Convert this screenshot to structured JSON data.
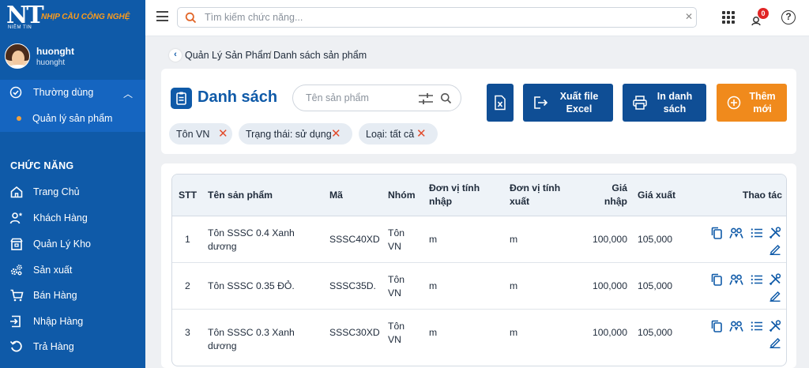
{
  "brand": {
    "logo_text": "NT",
    "logo_sub": "NIỀM TIN",
    "slogan": "NHỊP CẦU CÔNG NGHỆ"
  },
  "user": {
    "name": "huonght",
    "login": "huonght"
  },
  "favorites": {
    "label": "Thường dùng",
    "items": [
      {
        "label": "Quản lý sản phẩm"
      }
    ]
  },
  "section_title": "CHỨC NĂNG",
  "nav": [
    {
      "label": "Trang Chủ",
      "icon": "home-icon"
    },
    {
      "label": "Khách Hàng",
      "icon": "user-star-icon"
    },
    {
      "label": "Quản Lý Kho",
      "icon": "warehouse-icon"
    },
    {
      "label": "Sản xuất",
      "icon": "gears-icon"
    },
    {
      "label": "Bán Hàng",
      "icon": "cart-icon"
    },
    {
      "label": "Nhập Hàng",
      "icon": "login-icon"
    },
    {
      "label": "Trả Hàng",
      "icon": "return-icon"
    }
  ],
  "topbar": {
    "search_placeholder": "Tìm kiếm chức năng...",
    "notifications": "0"
  },
  "breadcrumb": {
    "parent": "Quản Lý Sản Phẩm",
    "separator": "/",
    "current": "Danh sách sản phẩm"
  },
  "page": {
    "title": "Danh sách",
    "search_placeholder": "Tên sản phẩm"
  },
  "buttons": {
    "export": "Xuất file Excel",
    "print": "In danh sách",
    "add": "Thêm mới"
  },
  "filters": [
    {
      "label": "Tôn VN"
    },
    {
      "label": "Trạng thái: sử dụng"
    },
    {
      "label": "Loại: tất cả"
    }
  ],
  "table": {
    "headers": {
      "stt": "STT",
      "name": "Tên sản phẩm",
      "code": "Mã",
      "group": "Nhóm",
      "unit_in": "Đơn vị tính nhập",
      "unit_out": "Đơn vị tính xuất",
      "price_in": "Giá nhập",
      "price_out": "Giá xuất",
      "actions": "Thao tác"
    },
    "rows": [
      {
        "stt": "1",
        "name": "Tôn SSSC 0.4 Xanh dương",
        "code": "SSSC40XD",
        "group": "Tôn VN",
        "unit_in": "m",
        "unit_out": "m",
        "price_in": "100,000",
        "price_out": "105,000"
      },
      {
        "stt": "2",
        "name": "Tôn SSSC 0.35 ĐỎ.",
        "code": "SSSC35D.",
        "group": "Tôn VN",
        "unit_in": "m",
        "unit_out": "m",
        "price_in": "100,000",
        "price_out": "105,000"
      },
      {
        "stt": "3",
        "name": "Tôn SSSC 0.3 Xanh dương",
        "code": "SSSC30XD",
        "group": "Tôn VN",
        "unit_in": "m",
        "unit_out": "m",
        "price_in": "100,000",
        "price_out": "105,000"
      }
    ]
  },
  "colors": {
    "primary": "#0f5aa8",
    "accent": "#f08a1c",
    "danger": "#e24b2b"
  }
}
